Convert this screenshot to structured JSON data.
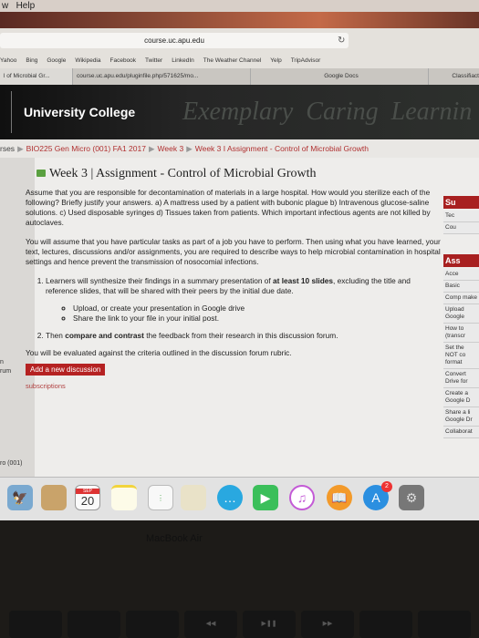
{
  "menubar": {
    "items": [
      "w",
      "Help"
    ]
  },
  "browser": {
    "url": "course.uc.apu.edu",
    "bookmarks": [
      "Yahoo",
      "Bing",
      "Google",
      "Wikipedia",
      "Facebook",
      "Twitter",
      "LinkedIn",
      "The Weather Channel",
      "Yelp",
      "TripAdvisor"
    ],
    "tabs": [
      "l of Microbial Gr...",
      "course.uc.apu.edu/pluginfile.php/571625/mo...",
      "Google Docs",
      "Classifiact"
    ]
  },
  "header": {
    "site_name": "University College",
    "mottos": [
      "Exemplary",
      "Caring",
      "Learnin"
    ]
  },
  "breadcrumb": {
    "items": [
      "rses",
      "BIO225 Gen Micro (001) FA1 2017",
      "Week 3",
      "Week 3 I Assignment - Control of Microbial Growth"
    ]
  },
  "left_sidebar": {
    "items": [
      "n",
      "rum",
      "ro (001)"
    ]
  },
  "main": {
    "title": "Week 3 | Assignment - Control of Microbial Growth",
    "para1": "Assume that you are responsible for decontamination of materials in a large hospital. How would you sterilize each of the following? Briefly justify your answers. a) A mattress used by a patient with bubonic plague b) Intravenous glucose-saline solutions. c) Used disposable syringes d) Tissues taken from patients. Which important infectious agents are not killed by autoclaves.",
    "para2": "You will assume that you have particular tasks as part of a job you have to perform. Then using what you have learned, your text, lectures, discussions and/or assignments, you are required to describe ways to help microbial contamination in hospital settings and hence prevent the transmission of nosocomial infections.",
    "step1_pre": "Learners will synthesize their findings in a summary presentation of ",
    "step1_bold": "at least 10 slides",
    "step1_post": ", excluding the title and reference slides, that will be shared with their peers by the initial due date.",
    "sub_items": [
      "Upload, or create your presentation in Google drive",
      "Share the link to your file in your initial post."
    ],
    "step2_pre": "Then ",
    "step2_bold": "compare and contrast",
    "step2_post": " the feedback from their research in this discussion forum.",
    "evaluation": "You will be evaluated against the criteria outlined in the discussion forum rubric.",
    "add_button": "Add a new discussion",
    "subscriptions": "subscriptions"
  },
  "right_sidebar": {
    "block1_title": "Su",
    "block1_items": [
      "Tec",
      "Cou"
    ],
    "block2_title": "Ass",
    "block2_items": [
      "Acce",
      "Basic",
      "Comp make",
      "Upload Google",
      "How to (transcr",
      "Set the NOT co format",
      "Convert Drive for",
      "Create a Google D",
      "Share a li Google Dr",
      "Collaborat"
    ]
  },
  "dock": {
    "calendar_month": "SEP",
    "calendar_day": "20",
    "app_store_badge": "2",
    "icons": [
      "preview-icon",
      "contacts-icon",
      "calendar-icon",
      "notes-icon",
      "reminders-icon",
      "photo-booth-icon",
      "messages-icon",
      "facetime-icon",
      "itunes-icon",
      "ibooks-icon",
      "app-store-icon",
      "system-preferences-icon"
    ]
  },
  "bezel": {
    "label": "MacBook Air"
  }
}
